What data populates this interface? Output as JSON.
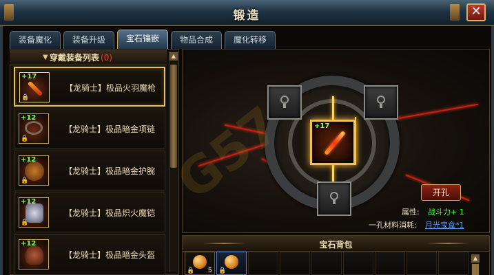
{
  "window": {
    "title": "锻造",
    "close_glyph": "✕"
  },
  "tabs": [
    {
      "label": "装备魔化",
      "active": false
    },
    {
      "label": "装备升级",
      "active": false
    },
    {
      "label": "宝石镶嵌",
      "active": true
    },
    {
      "label": "物品合成",
      "active": false
    },
    {
      "label": "魔化转移",
      "active": false
    }
  ],
  "equipment_list": {
    "header": "穿戴装备列表",
    "count": "(0)",
    "items": [
      {
        "name": "【龙骑士】极品火羽魔枪",
        "plus": "+17",
        "icon": "spear-icon",
        "selected": true
      },
      {
        "name": "【龙骑士】极品暗金项链",
        "plus": "+12",
        "icon": "necklace-icon",
        "selected": false
      },
      {
        "name": "【龙骑士】极品暗金护腕",
        "plus": "+12",
        "icon": "bracer-icon",
        "selected": false
      },
      {
        "name": "【龙骑士】极品炽火魔铠",
        "plus": "+12",
        "icon": "armor-icon",
        "selected": false
      },
      {
        "name": "【龙骑士】极品暗金头盔",
        "plus": "+12",
        "icon": "helmet-icon",
        "selected": false
      }
    ]
  },
  "socket_panel": {
    "center_plus": "+17",
    "open_button": "开孔",
    "attr_label": "属性:",
    "attr_value": "战斗力+ 1",
    "material_label": "一孔材料消耗:",
    "material_value": "月光宝盒*1"
  },
  "gem_bag": {
    "title": "宝石背包",
    "slots": [
      {
        "filled": true,
        "qty": "5",
        "highlight": false
      },
      {
        "filled": true,
        "qty": "",
        "highlight": true
      },
      {
        "filled": false
      },
      {
        "filled": false
      },
      {
        "filled": false
      },
      {
        "filled": false
      },
      {
        "filled": false
      },
      {
        "filled": false
      },
      {
        "filled": false
      }
    ]
  },
  "colors": {
    "accent_gold": "#e6c160",
    "highlight_green": "#4cff3a",
    "link_blue": "#4f9cff",
    "warning_red": "#e04432"
  }
}
